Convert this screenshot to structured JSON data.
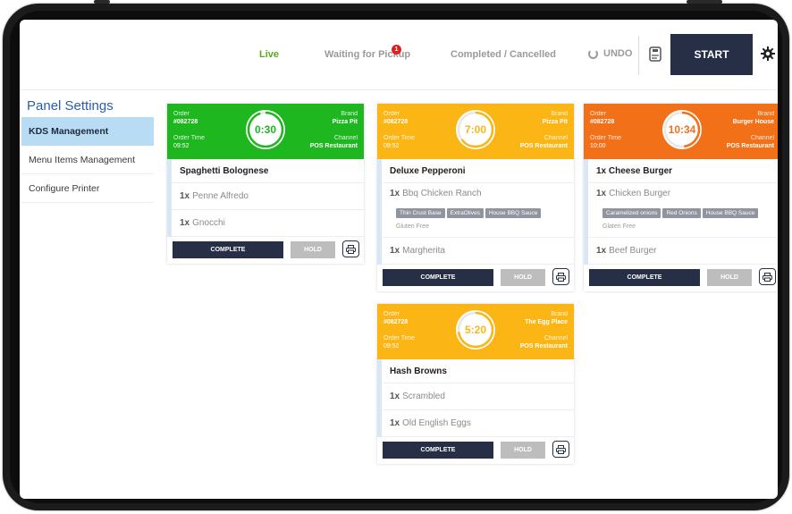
{
  "header": {
    "tabs": [
      {
        "label": "Live"
      },
      {
        "label": "Waiting for Pickup",
        "badge": "1"
      },
      {
        "label": "Completed / Cancelled"
      }
    ],
    "undo_label": "UNDO",
    "start_label": "START"
  },
  "sidebar": {
    "title": "Panel Settings",
    "items": [
      {
        "label": "KDS Management",
        "active": true
      },
      {
        "label": "Menu Items Management"
      },
      {
        "label": "Configure Printer"
      }
    ]
  },
  "common": {
    "order_label": "Order",
    "order_time_label": "Order Time",
    "brand_label": "Brand",
    "channel_label": "Channel",
    "complete_label": "COMPLETE",
    "hold_label": "HOLD"
  },
  "orders": [
    {
      "color": "#1fb71f",
      "order_no": "#082728",
      "order_time": "09:52",
      "brand": "Pizza Pit",
      "channel": "POS Restaurant",
      "timer": "0:30",
      "timer_progress": 0.05,
      "title": "Spaghetti Bolognese",
      "lines": [
        {
          "qty": "1x",
          "name": "Penne Alfredo"
        },
        {
          "qty": "1x",
          "name": "Gnocchi"
        }
      ]
    },
    {
      "color": "#fbb615",
      "order_no": "#082728",
      "order_time": "09:52",
      "brand": "Pizza Pit",
      "channel": "POS Restaurant",
      "timer": "7:00",
      "timer_progress": 0.35,
      "title": "Deluxe Pepperoni",
      "lines": [
        {
          "qty": "1x",
          "name": "Bbq Chicken Ranch",
          "mods": [
            "Thin Crust Base",
            "ExtraOlives",
            "House BBQ Sauce"
          ],
          "note": "Gluten Free"
        },
        {
          "qty": "1x",
          "name": "Margherita"
        }
      ]
    },
    {
      "color": "#f27018",
      "order_no": "#082728",
      "order_time": "10:00",
      "brand": "Burger House",
      "channel": "POS Restaurant",
      "timer": "10:34",
      "timer_progress": 0.52,
      "title": "1x Cheese Burger",
      "lines": [
        {
          "qty": "1x",
          "name": "Chicken Burger",
          "mods": [
            "Caramelized onions",
            "Red Onions",
            "House BBQ Sauce"
          ],
          "note": "Glaten Free"
        },
        {
          "qty": "1x",
          "name": "Beef Burger"
        }
      ]
    },
    {
      "color": "#fbb615",
      "order_no": "#082728",
      "order_time": "09:52",
      "brand": "The Egg Place",
      "channel": "POS Restaurant",
      "timer": "5:20",
      "timer_progress": 0.27,
      "title": "Hash Browns",
      "lines": [
        {
          "qty": "1x",
          "name": "Scrambled"
        },
        {
          "qty": "1x",
          "name": "Old English Eggs"
        }
      ]
    }
  ]
}
